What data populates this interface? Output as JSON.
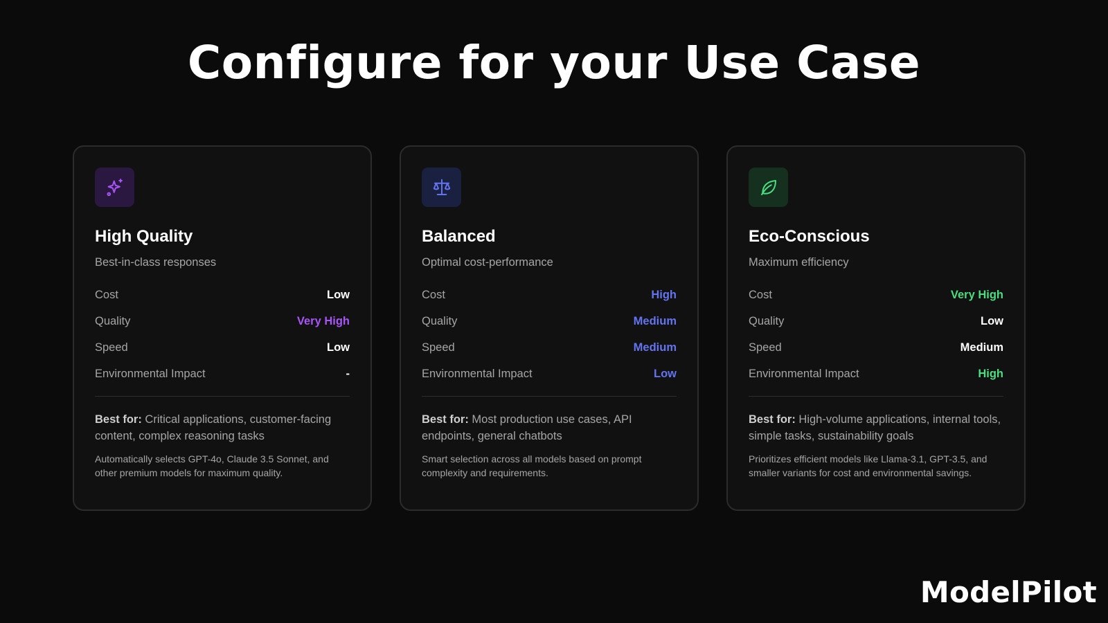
{
  "headline": "Configure for your Use Case",
  "brand": "ModelPilot",
  "colors": {
    "white": "#ffffff",
    "purple": "#a855f7",
    "blue": "#6474f0",
    "green": "#4ade80",
    "purple_tile": "#2a1840",
    "blue_tile": "#1a2140",
    "green_tile": "#15301f"
  },
  "cards": [
    {
      "icon": "sparkles-icon",
      "title": "High Quality",
      "subtitle": "Best-in-class responses",
      "metrics": [
        {
          "label": "Cost",
          "value": "Low",
          "color": "#ffffff"
        },
        {
          "label": "Quality",
          "value": "Very High",
          "color": "#a855f7"
        },
        {
          "label": "Speed",
          "value": "Low",
          "color": "#ffffff"
        },
        {
          "label": "Environmental Impact",
          "value": "-",
          "color": "#ffffff"
        }
      ],
      "best_for_label": "Best for:",
      "best_for_text": " Critical applications, customer-facing content, complex reasoning tasks",
      "description": "Automatically selects GPT-4o, Claude 3.5 Sonnet, and other premium models for maximum quality."
    },
    {
      "icon": "scale-icon",
      "title": "Balanced",
      "subtitle": "Optimal cost-performance",
      "metrics": [
        {
          "label": "Cost",
          "value": "High",
          "color": "#6474f0"
        },
        {
          "label": "Quality",
          "value": "Medium",
          "color": "#6474f0"
        },
        {
          "label": "Speed",
          "value": "Medium",
          "color": "#6474f0"
        },
        {
          "label": "Environmental Impact",
          "value": "Low",
          "color": "#6474f0"
        }
      ],
      "best_for_label": "Best for:",
      "best_for_text": " Most production use cases, API endpoints, general chatbots",
      "description": "Smart selection across all models based on prompt complexity and requirements."
    },
    {
      "icon": "leaf-icon",
      "title": "Eco-Conscious",
      "subtitle": "Maximum efficiency",
      "metrics": [
        {
          "label": "Cost",
          "value": "Very High",
          "color": "#4ade80"
        },
        {
          "label": "Quality",
          "value": "Low",
          "color": "#ffffff"
        },
        {
          "label": "Speed",
          "value": "Medium",
          "color": "#ffffff"
        },
        {
          "label": "Environmental Impact",
          "value": "High",
          "color": "#4ade80"
        }
      ],
      "best_for_label": "Best for:",
      "best_for_text": " High-volume applications, internal tools, simple tasks, sustainability goals",
      "description": "Prioritizes efficient models like Llama-3.1, GPT-3.5, and smaller variants for cost and environmental savings."
    }
  ]
}
